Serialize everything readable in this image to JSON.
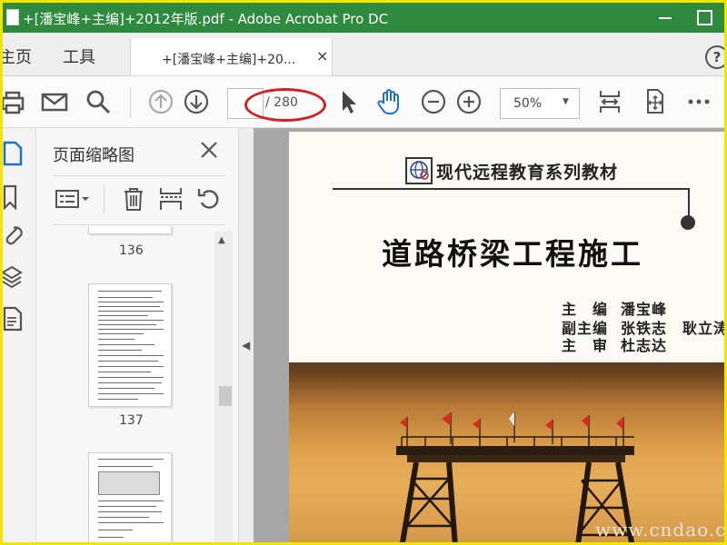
{
  "window": {
    "title": "+[潘宝峰+主编]+2012年版.pdf - Adobe Acrobat Pro DC"
  },
  "tabs": {
    "home": "主页",
    "tools": "工具",
    "document": "+[潘宝峰+主编]+20...",
    "close": "×",
    "help": "?"
  },
  "toolbar": {
    "page_current": "",
    "page_total": "/ 280",
    "zoom": "50%"
  },
  "thumbnails_panel": {
    "title": "页面缩略图",
    "pages": [
      {
        "label": "136"
      },
      {
        "label": "137"
      }
    ]
  },
  "document": {
    "series": "现代远程教育系列教材",
    "title": "道路桥梁工程施工",
    "credits": [
      {
        "role": "主　编",
        "name": "潘宝峰"
      },
      {
        "role": "副主编",
        "name": "张铁志　耿立涛"
      },
      {
        "role": "主　审",
        "name": "杜志达"
      }
    ]
  },
  "watermark": "www.cndao.com",
  "colors": {
    "titlebar": "#2d8a3e",
    "outer_border": "#f2e600",
    "highlight": "#d32020"
  }
}
